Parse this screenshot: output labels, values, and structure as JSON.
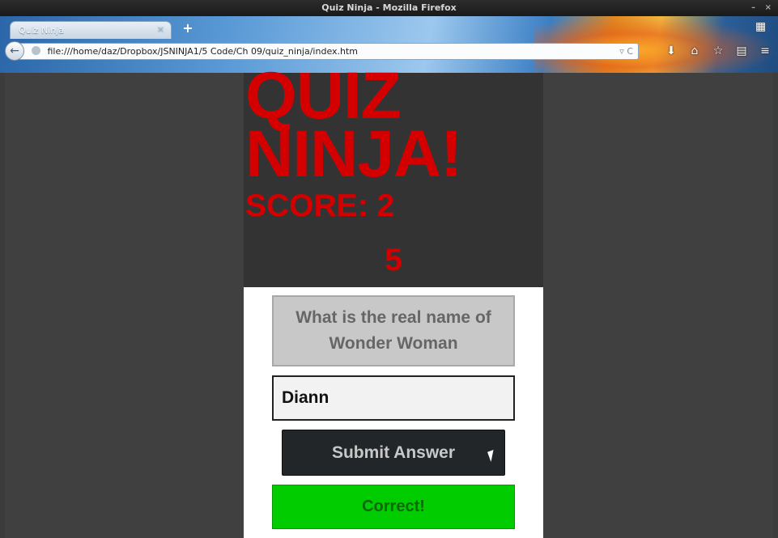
{
  "window": {
    "title": "Quiz Ninja - Mozilla Firefox",
    "controls": "– ×"
  },
  "browser": {
    "tab_label": "Quiz Ninja",
    "tab_close": "×",
    "new_tab": "+",
    "url": "file:///home/daz/Dropbox/JSNINJA1/5 Code/Ch 09/quiz_ninja/index.htm",
    "reload_glyph": "▿ C",
    "icons": [
      "download-icon",
      "home-icon",
      "bookmark-star-icon",
      "reading-list-icon",
      "menu-icon"
    ]
  },
  "page": {
    "logo_line1": "QUIZ",
    "logo_line2": "NINJA!",
    "score": "SCORE: 2",
    "timer": "5",
    "question": "What is the real name of Wonder Woman",
    "answer_value": "Diann",
    "submit_label": "Submit Answer",
    "feedback": "Correct!"
  },
  "colors": {
    "accent_red": "#d40000",
    "header_bg": "#333333",
    "feedback_bg": "#00cc00"
  }
}
